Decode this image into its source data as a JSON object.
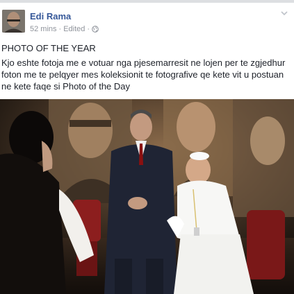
{
  "post": {
    "author": "Edi Rama",
    "time": "52 mins",
    "separator": "·",
    "edited": "Edited",
    "separator2": "·",
    "heading": "PHOTO OF THE YEAR",
    "body": "Kjo eshte fotoja me e votuar nga pjesemarresit ne lojen per te zgjedhur foton me te pelqyer mes koleksionit te fotografive qe kete vit u postuan ne kete faqe si Photo of the Day"
  },
  "icons": {
    "audience": "globe-icon",
    "options": "chevron-down-icon"
  },
  "colors": {
    "author_link": "#365899",
    "meta_text": "#90949c",
    "body_text": "#1d2129",
    "photo_background": "#1a1511"
  }
}
